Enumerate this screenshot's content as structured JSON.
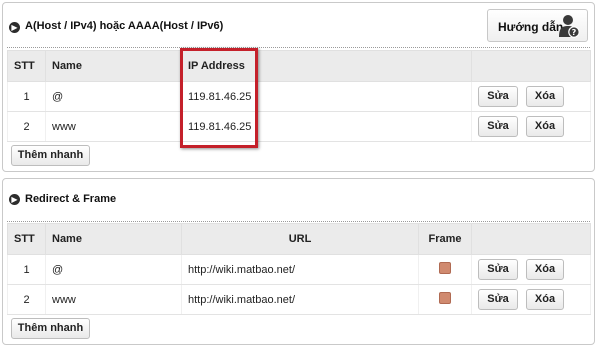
{
  "section_a": {
    "title": "A(Host / IPv4) hoặc AAAA(Host / IPv6)",
    "guide_button": "Hướng dẫn",
    "columns": [
      "STT",
      "Name",
      "IP Address",
      ""
    ],
    "rows": [
      {
        "stt": "1",
        "name": "@",
        "ip": "119.81.46.25"
      },
      {
        "stt": "2",
        "name": "www",
        "ip": "119.81.46.25"
      }
    ],
    "edit_label": "Sửa",
    "delete_label": "Xóa",
    "add_button": "Thêm nhanh"
  },
  "section_redirect": {
    "title": "Redirect & Frame",
    "columns": [
      "STT",
      "Name",
      "URL",
      "Frame",
      ""
    ],
    "rows": [
      {
        "stt": "1",
        "name": "@",
        "url": "http://wiki.matbao.net/"
      },
      {
        "stt": "2",
        "name": "www",
        "url": "http://wiki.matbao.net/"
      }
    ],
    "edit_label": "Sửa",
    "delete_label": "Xóa",
    "add_button": "Thêm nhanh"
  },
  "colors": {
    "highlight": "#c4202a",
    "frame_indicator": "#d08a6f",
    "header_bg": "#ebebeb"
  },
  "icons": [
    "play-circle-icon",
    "user-help-icon"
  ]
}
